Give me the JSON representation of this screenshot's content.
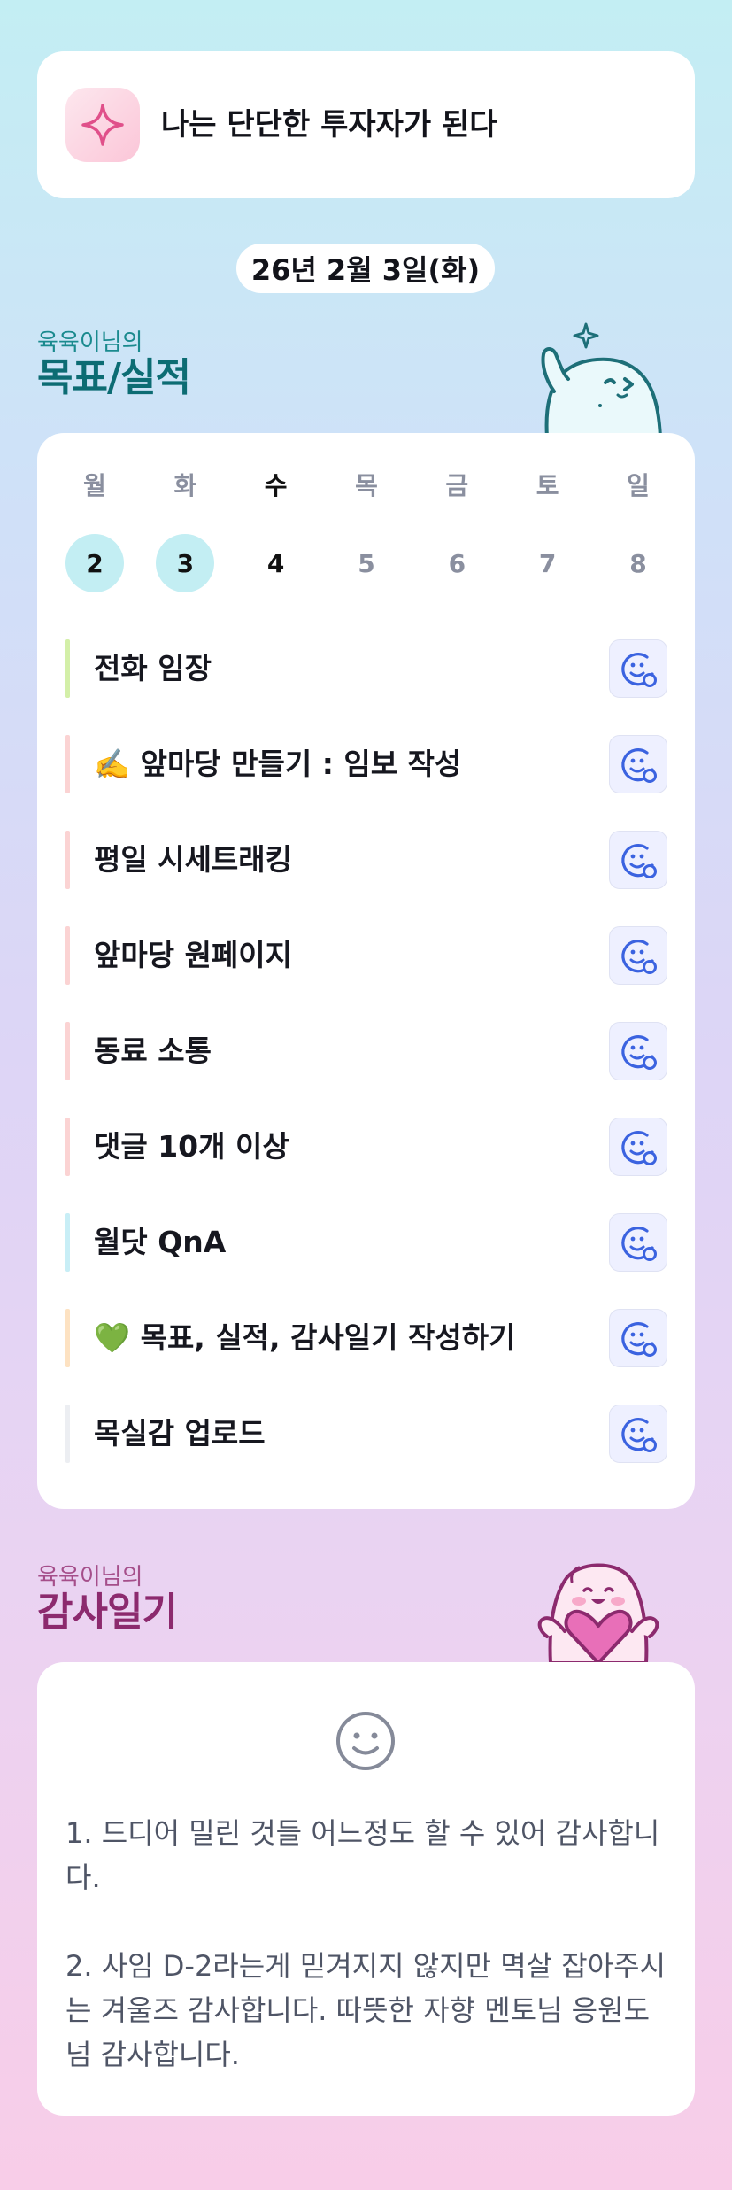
{
  "motto": {
    "text": "나는 단단한 투자자가 된다",
    "icon": "sparkle-icon"
  },
  "date": {
    "label": "26년 2월 3일(화)"
  },
  "goals_section": {
    "subtitle": "육육이님의",
    "title": "목표/실적"
  },
  "week": [
    {
      "dow": "월",
      "day": "2",
      "state": "done"
    },
    {
      "dow": "화",
      "day": "3",
      "state": "done"
    },
    {
      "dow": "수",
      "day": "4",
      "state": "today"
    },
    {
      "dow": "목",
      "day": "5",
      "state": "future"
    },
    {
      "dow": "금",
      "day": "6",
      "state": "future"
    },
    {
      "dow": "토",
      "day": "7",
      "state": "future"
    },
    {
      "dow": "일",
      "day": "8",
      "state": "future"
    }
  ],
  "goals": [
    {
      "text": "전화 임장",
      "color": "#d3efa8"
    },
    {
      "text": "✍️ 앞마당 만들기 : 임보 작성",
      "color": "#fbd3d3"
    },
    {
      "text": "평일 시세트래킹",
      "color": "#fbd3d3"
    },
    {
      "text": "앞마당 원페이지",
      "color": "#fbd3d3"
    },
    {
      "text": "동료 소통",
      "color": "#fbd3d3"
    },
    {
      "text": "댓글 10개 이상",
      "color": "#fbd3d3"
    },
    {
      "text": "월닷 QnA",
      "color": "#c8eef6"
    },
    {
      "text": "💚 목표, 실적, 감사일기 작성하기",
      "color": "#fde2c2"
    },
    {
      "text": "목실감 업로드",
      "color": "#eceef2"
    }
  ],
  "goal_button_icon": "smiley-add-icon",
  "gratitude_section": {
    "subtitle": "육육이님의",
    "title": "감사일기"
  },
  "gratitude": {
    "icon": "smiley-icon",
    "text": "1. 드디어 밀린 것들 어느정도 할 수 있어 감사합니다.\n\n2. 사임 D-2라는게 믿겨지지 않지만 멱살 잡아주시는 겨울즈 감사합니다. 따뜻한 자향 멘토님 응원도 넘 감사합니다."
  },
  "colors": {
    "accent_blue": "#3b63e0",
    "teal_title": "#0c6c73",
    "pink_title": "#8c2a6e",
    "done_circle": "#c3eef3"
  }
}
